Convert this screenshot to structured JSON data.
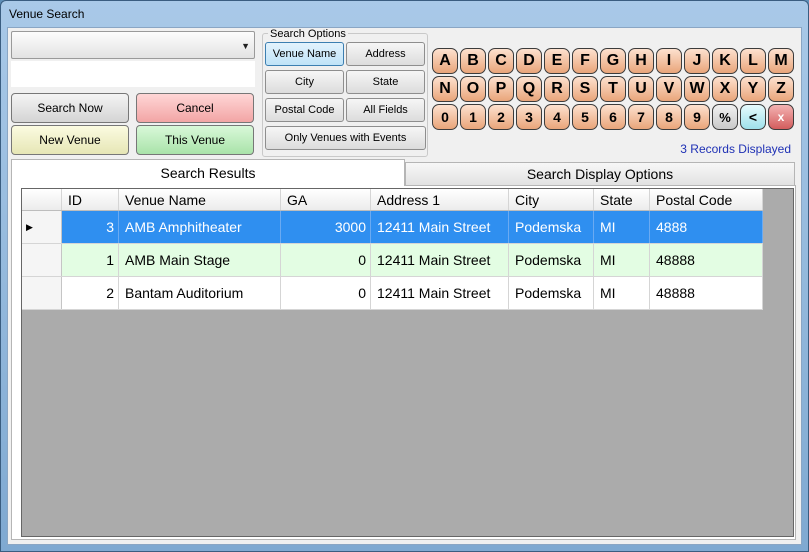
{
  "window": {
    "title": "Venue Search"
  },
  "controls": {
    "search_now": "Search Now",
    "cancel": "Cancel",
    "new_venue": "New Venue",
    "this_venue": "This Venue",
    "combo_arrow": "▼"
  },
  "search_options": {
    "legend": "Search Options",
    "venue_name": "Venue Name",
    "address": "Address",
    "city": "City",
    "state": "State",
    "postal_code": "Postal Code",
    "all_fields": "All Fields",
    "only_events": "Only Venues with Events",
    "selected": "Venue Name"
  },
  "keys": {
    "row1": [
      "A",
      "B",
      "C",
      "D",
      "E",
      "F",
      "G",
      "H",
      "I",
      "J",
      "K",
      "L",
      "M"
    ],
    "row2": [
      "N",
      "O",
      "P",
      "Q",
      "R",
      "S",
      "T",
      "U",
      "V",
      "W",
      "X",
      "Y",
      "Z"
    ],
    "row3": [
      "0",
      "1",
      "2",
      "3",
      "4",
      "5",
      "6",
      "7",
      "8",
      "9",
      "%",
      "<",
      "x"
    ]
  },
  "records_text": "3 Records Displayed",
  "tabs": {
    "results": "Search Results",
    "display": "Search Display Options"
  },
  "grid": {
    "columns": [
      "ID",
      "Venue Name",
      "GA",
      "Address 1",
      "City",
      "State",
      "Postal Code"
    ],
    "rows": [
      {
        "id": "3",
        "name": "AMB Amphitheater",
        "ga": "3000",
        "address": "12411 Main Street",
        "city": "Podemska",
        "state": "MI",
        "postal": "4888",
        "indicator": "▶"
      },
      {
        "id": "1",
        "name": "AMB Main Stage",
        "ga": "0",
        "address": "12411 Main Street",
        "city": "Podemska",
        "state": "MI",
        "postal": "48888",
        "indicator": ""
      },
      {
        "id": "2",
        "name": "Bantam Auditorium",
        "ga": "0",
        "address": "12411 Main Street",
        "city": "Podemska",
        "state": "MI",
        "postal": "48888",
        "indicator": ""
      }
    ]
  }
}
